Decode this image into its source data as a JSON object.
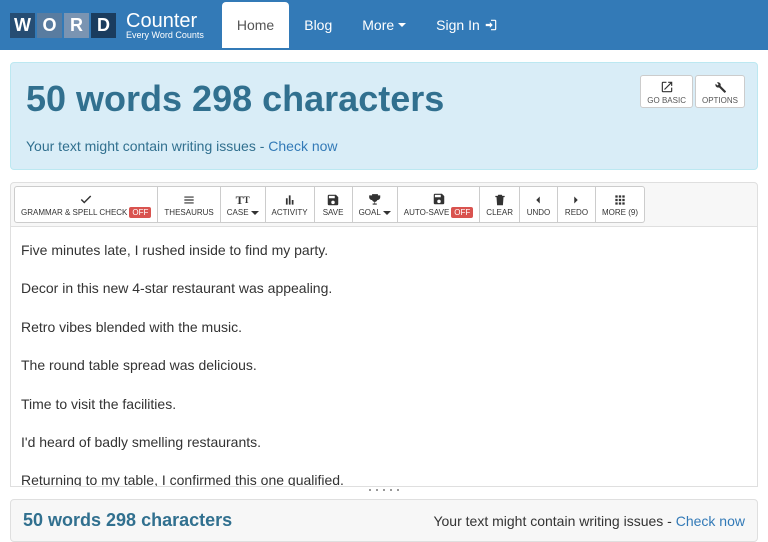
{
  "brand": {
    "word": "WORD",
    "title": "Counter",
    "tagline": "Every Word Counts"
  },
  "nav": {
    "home": "Home",
    "blog": "Blog",
    "more": "More",
    "signin": "Sign In"
  },
  "hero": {
    "headline": "50 words 298 characters",
    "issue_pre": "Your text might contain writing issues - ",
    "issue_link": "Check now",
    "go_basic": "GO BASIC",
    "options": "OPTIONS"
  },
  "toolbar": {
    "grammar": "GRAMMAR & SPELL CHECK",
    "grammar_badge": "OFF",
    "thesaurus": "THESAURUS",
    "case": "CASE",
    "activity": "ACTIVITY",
    "save": "SAVE",
    "goal": "GOAL",
    "autosave": "AUTO-SAVE",
    "autosave_badge": "OFF",
    "clear": "CLEAR",
    "undo": "UNDO",
    "redo": "REDO",
    "more": "MORE (9)"
  },
  "editor": {
    "p1": "Five minutes late, I rushed inside to find my party.",
    "p2": "Decor in this new 4-star restaurant was appealing.",
    "p3": "Retro vibes blended with the music.",
    "p4": "The round table spread was delicious.",
    "p5": "Time to visit the facilities.",
    "p6": "I'd heard of badly smelling restaurants.",
    "p7": "Returning to my table, I confirmed this one qualified."
  },
  "footer": {
    "count": "50 words 298 characters",
    "issue_pre": "Your text might contain writing issues - ",
    "issue_link": "Check now"
  }
}
